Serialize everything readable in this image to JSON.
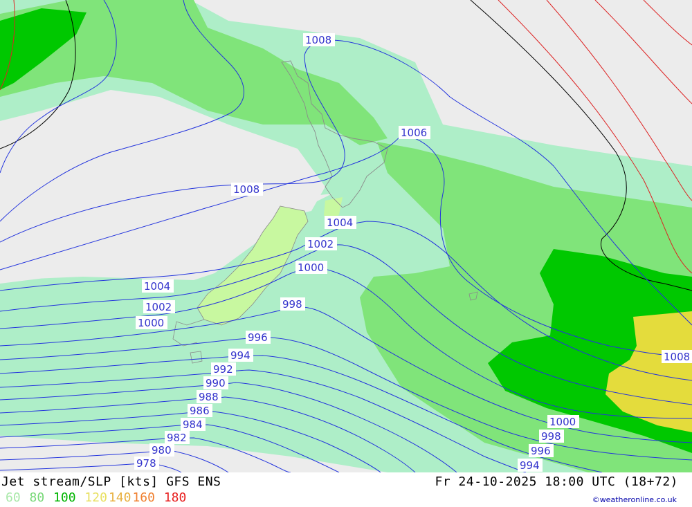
{
  "map": {
    "isobars": [
      "1008",
      "1006",
      "1008",
      "1004",
      "1002",
      "1000",
      "998",
      "1004",
      "1002",
      "1000",
      "996",
      "994",
      "992",
      "990",
      "988",
      "986",
      "984",
      "982",
      "980",
      "978",
      "1008",
      "1000",
      "998",
      "996",
      "994"
    ]
  },
  "footer": {
    "title": "Jet stream/SLP [kts] GFS ENS",
    "datetime": "Fr 24-10-2025 18:00 UTC (18+72)",
    "legend": [
      {
        "label": "60",
        "color": "#a8e8a8"
      },
      {
        "label": "80",
        "color": "#78d878"
      },
      {
        "label": "100",
        "color": "#00b400"
      },
      {
        "label": "120",
        "color": "#e8e060"
      },
      {
        "label": "140",
        "color": "#e8b040"
      },
      {
        "label": "160",
        "color": "#f08030"
      },
      {
        "label": "180",
        "color": "#e82020"
      }
    ],
    "credit": "©weatheronline.co.uk"
  },
  "colors": {
    "background": "#ececec",
    "band_60": "#aeeec8",
    "band_80": "#80e47a",
    "band_100": "#00c800",
    "band_120": "#e4dc3c",
    "land": "#c8f8a0",
    "isobar": "#2233dd",
    "contour_black": "#000000",
    "contour_red": "#dd2222"
  }
}
